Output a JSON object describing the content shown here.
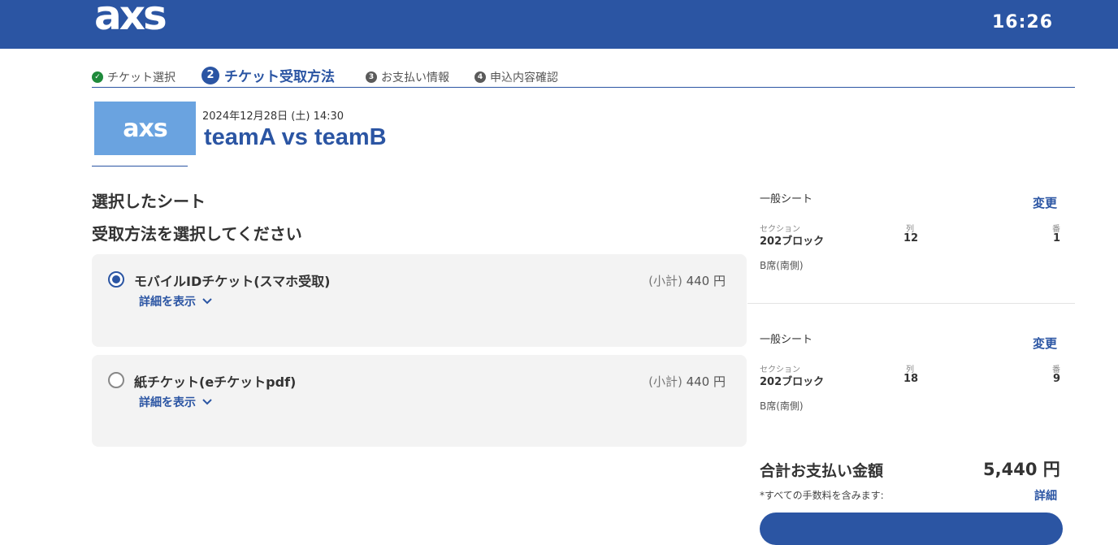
{
  "header": {
    "logo_text": "axs",
    "timer": "16:26"
  },
  "steps": [
    {
      "icon": "check",
      "label": "チケット選択",
      "state": "done"
    },
    {
      "icon": "2",
      "label": "チケット受取方法",
      "state": "active"
    },
    {
      "icon": "3",
      "label": "お支払い情報",
      "state": "pending"
    },
    {
      "icon": "4",
      "label": "申込内容確認",
      "state": "pending"
    }
  ],
  "event": {
    "thumbnail_logo": "axs",
    "date": "2024年12月28日 (土) 14:30",
    "title": "teamA vs teamB"
  },
  "main": {
    "selected_seats_heading": "選択したシート",
    "delivery_heading": "受取方法を選択してください",
    "options": [
      {
        "label": "モバイルIDチケット(スマホ受取)",
        "price_prefix": "(小計)",
        "price": "440 円",
        "detail_link": "詳細を表示",
        "selected": true
      },
      {
        "label": "紙チケット(eチケットpdf)",
        "price_prefix": "(小計)",
        "price": "440 円",
        "detail_link": "詳細を表示",
        "selected": false
      }
    ]
  },
  "seats": [
    {
      "type": "一般シート",
      "change_label": "変更",
      "section_caption": "セクション",
      "section": "202ブロック",
      "row_caption": "列",
      "row": "12",
      "seat_caption": "番",
      "seat": "1",
      "area": "B席(南側)"
    },
    {
      "type": "一般シート",
      "change_label": "変更",
      "section_caption": "セクション",
      "section": "202ブロック",
      "row_caption": "列",
      "row": "18",
      "seat_caption": "番",
      "seat": "9",
      "area": "B席(南側)"
    }
  ],
  "summary": {
    "total_label": "合計お支払い金額",
    "total_value": "5,440 円",
    "fee_note": "*すべての手数料を含みます:",
    "fee_link": "詳細"
  },
  "colors": {
    "brand": "#2b55a3",
    "done": "#1f8a3b",
    "panel": "#f3f3f3"
  }
}
